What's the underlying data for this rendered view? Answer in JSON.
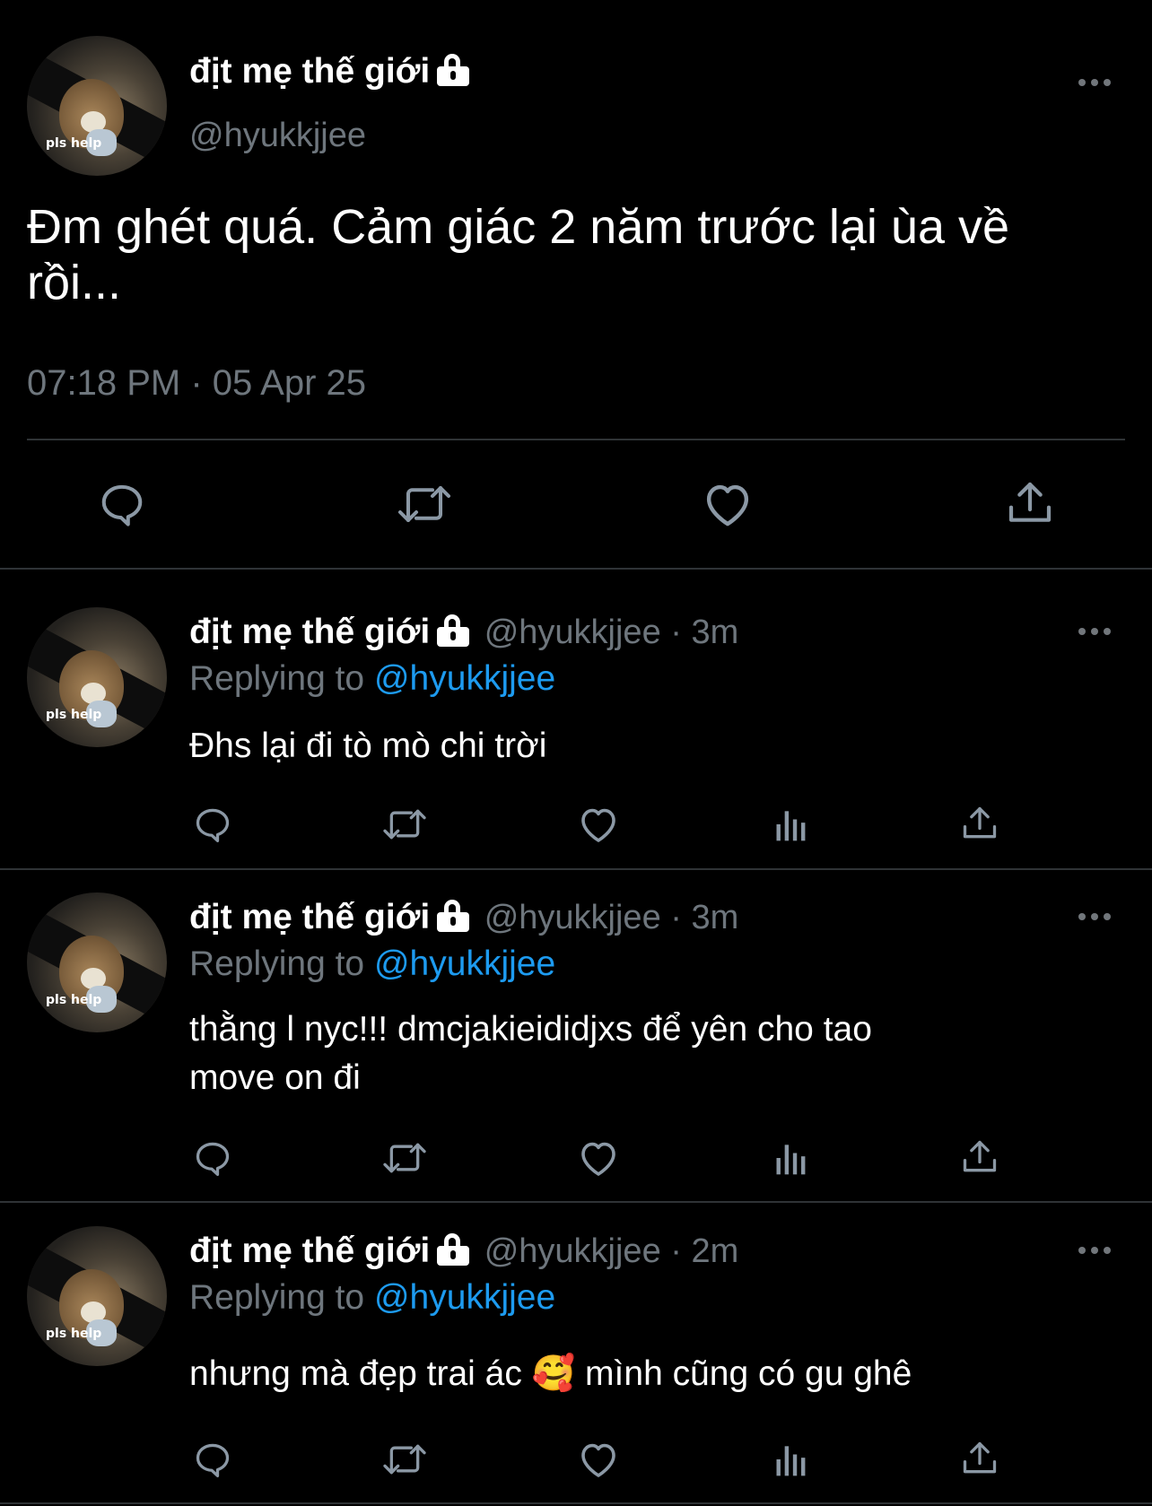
{
  "main_tweet": {
    "display_name": "địt mẹ thế giới",
    "handle": "@hyukkjjee",
    "avatar_caption": "pls help",
    "text_line1": "Đm ghét quá. Cảm giác 2 năm trước lại ùa về",
    "text_line2": "rồi...",
    "timestamp": "07:18 PM · 05 Apr 25",
    "icons": [
      "reply-icon",
      "retweet-icon",
      "like-icon",
      "share-icon"
    ]
  },
  "replies": [
    {
      "display_name": "địt mẹ thế giới",
      "handle_time": "@hyukkjjee · 3m",
      "replying_prefix": "Replying to",
      "replying_handle": "@hyukkjjee",
      "avatar_caption": "pls help",
      "text_line1": "Đhs lại đi tò mò chi trời",
      "text_line2": ""
    },
    {
      "display_name": "địt mẹ thế giới",
      "handle_time": "@hyukkjjee · 3m",
      "replying_prefix": "Replying to",
      "replying_handle": "@hyukkjjee",
      "avatar_caption": "pls help",
      "text_line1": "thằng l nyc!!! dmcjakieididjxs để yên cho tao",
      "text_line2": "move on đi"
    },
    {
      "display_name": "địt mẹ thế giới",
      "handle_time": "@hyukkjjee · 2m",
      "replying_prefix": "Replying to",
      "replying_handle": "@hyukkjjee",
      "avatar_caption": "pls help",
      "text_line1": "nhưng mà đẹp trai ác 🥰  mình cũng có gu ghê",
      "text_line2": ""
    }
  ],
  "colors": {
    "background": "#000000",
    "text": "#e7e9ea",
    "muted": "#6e767d",
    "link": "#1d9bf0",
    "divider": "#2f3336"
  }
}
